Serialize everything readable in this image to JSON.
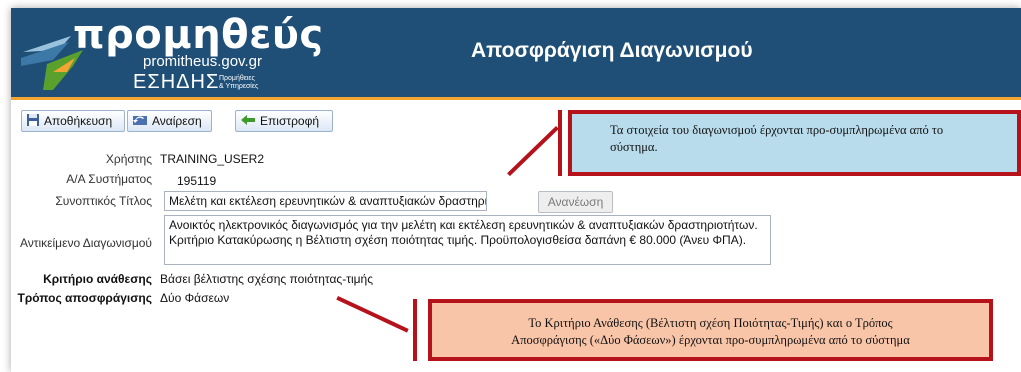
{
  "header": {
    "logo_word": "προμηθεύς",
    "logo_domain": "promitheus.gov.gr",
    "logo_esidis": "ΕΣΗΔΗΣ",
    "logo_small_1": "Προμήθειες",
    "logo_small_2": "& Υπηρεσίες",
    "title": "Αποσφράγιση Διαγωνισμού"
  },
  "toolbar": {
    "save": "Αποθήκευση",
    "undo": "Αναίρεση",
    "back": "Επιστροφή"
  },
  "form": {
    "user_label": "Χρήστης",
    "user_value": "TRAINING_USER2",
    "system_no_label": "Α/Α Συστήματος",
    "system_no_value": "195119",
    "short_title_label": "Συνοπτικός Τίτλος",
    "short_title_value": "Μελέτη και εκτέλεση ερευνητικών & αναπτυξιακών δραστηρι",
    "refresh_button": "Ανανέωση",
    "subject_label": "Αντικείμενο Διαγωνισμού",
    "subject_value": "Ανοικτός ηλεκτρονικός διαγωνισμός για την  μελέτη και εκτέλεση ερευνητικών & αναπτυξιακών δραστηριοτήτων. Κριτήριο Κατακύρωσης η Βέλτιστη σχέση ποιότητας τιμής. Προϋπολογισθείσα δαπάνη € 80.000 (Άνευ ΦΠΑ).",
    "criterion_label": "Κριτήριο ανάθεσης",
    "criterion_value": "Βάσει βέλτιστης σχέσης ποιότητας-τιμής",
    "unsealing_label": "Τρόπος αποσφράγισης",
    "unsealing_value": "Δύο Φάσεων"
  },
  "callouts": {
    "top": "Τα στοιχεία του διαγωνισμού έρχονται προ-συμπληρωμένα από το σύστημα.",
    "bottom_line1": "Το Κριτήριο Ανάθεσης (Βέλτιστη σχέση Ποιότητας-Τιμής)  και ο Τρόπος",
    "bottom_line2": "Αποσφράγισης («Δύο Φάσεων») έρχονται προ-συμπληρωμένα από το σύστημα"
  },
  "colors": {
    "header_bg": "#1f4f77",
    "accent_orange": "#f3a531",
    "callout_border": "#b5121b",
    "callout_blue": "#b9dcec",
    "callout_peach": "#f9c5a8"
  }
}
